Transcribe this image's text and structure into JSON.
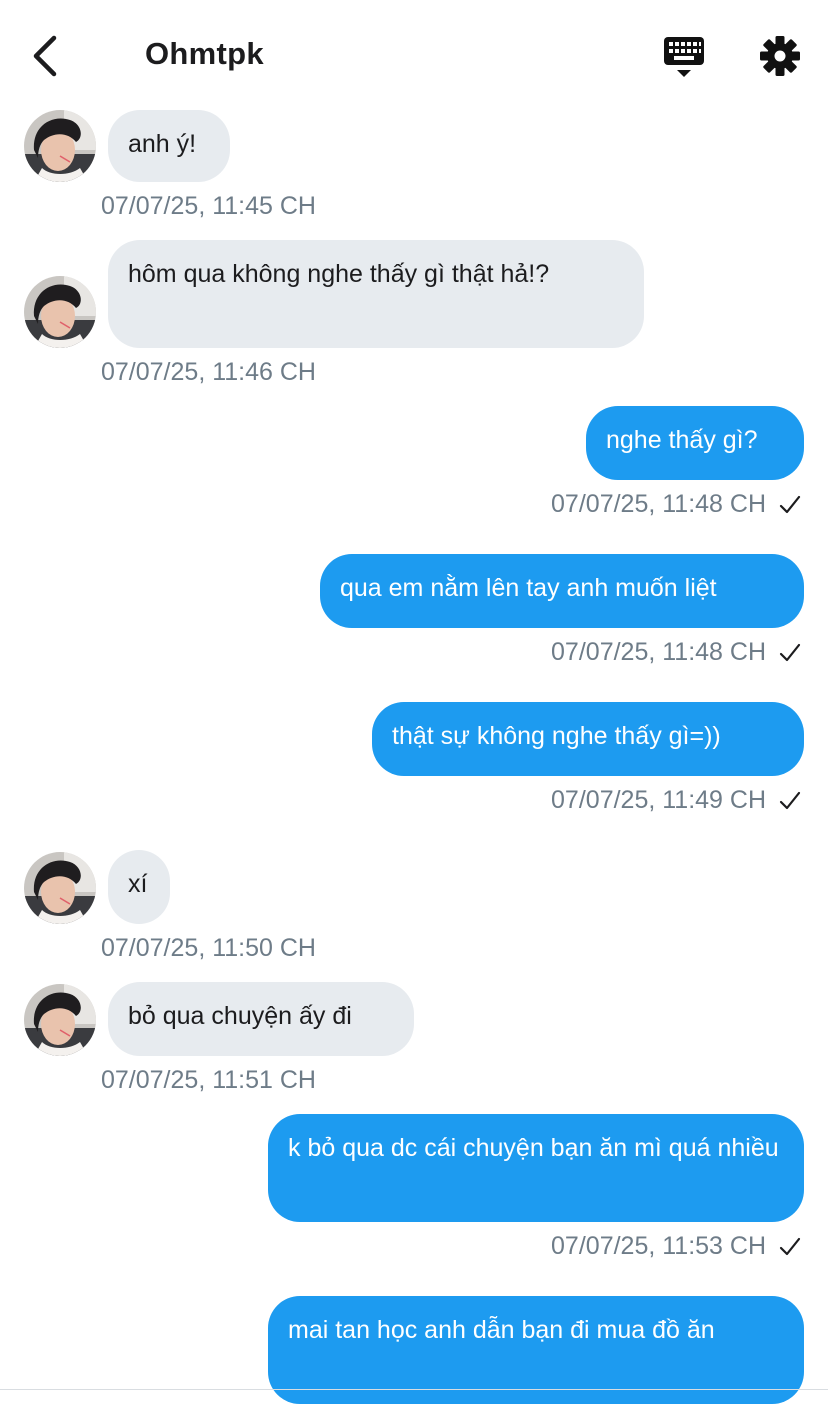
{
  "header": {
    "title": "Ohmtpk"
  },
  "icons": {
    "back": "chevron-left-icon",
    "keyboard": "keyboard-icon",
    "settings": "gear-icon",
    "read": "checkmark-icon"
  },
  "colors": {
    "outgoing_bubble": "#1d9bf0",
    "incoming_bubble": "#e7ebef",
    "timestamp": "#6e7c88"
  },
  "messages": [
    {
      "dir": "in",
      "text": "anh ý!",
      "time": "07/07/25, 11:45 CH"
    },
    {
      "dir": "in",
      "text": "hôm qua không nghe thấy gì thật hả!?",
      "time": "07/07/25, 11:46 CH"
    },
    {
      "dir": "out",
      "text": "nghe thấy gì?",
      "time": "07/07/25, 11:48 CH"
    },
    {
      "dir": "out",
      "text": "qua em nằm lên tay anh muốn liệt",
      "time": "07/07/25, 11:48 CH"
    },
    {
      "dir": "out",
      "text": "thật sự không nghe thấy gì=))",
      "time": "07/07/25, 11:49 CH"
    },
    {
      "dir": "in",
      "text": "xí",
      "time": "07/07/25, 11:50 CH"
    },
    {
      "dir": "in",
      "text": "bỏ qua chuyện ấy đi",
      "time": "07/07/25, 11:51 CH"
    },
    {
      "dir": "out",
      "text": "k bỏ qua dc cái chuyện bạn ăn mì quá nhiều",
      "time": "07/07/25, 11:53 CH"
    },
    {
      "dir": "out",
      "text": "mai tan học anh dẫn bạn đi mua đồ ăn",
      "time": ""
    }
  ]
}
